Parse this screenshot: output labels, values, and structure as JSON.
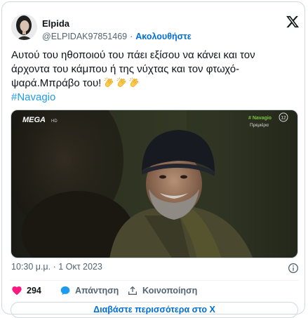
{
  "author": {
    "name": "Elpida",
    "handle": "@ELPIDAK97851469",
    "separator": "·",
    "follow_label": "Ακολουθήστε"
  },
  "tweet": {
    "text_lines": [
      "Αυτού του ηθοποιού του πάει εξίσου να κάνει και τον",
      "άρχοντα του κάμπου ή της νύχτας και τον φτωχό-",
      "ψαρά.Μπράβο του!"
    ],
    "emoji": [
      "clapping-hands",
      "clapping-hands",
      "clapping-hands"
    ],
    "hashtag": "#Navagio"
  },
  "media": {
    "channel_logo": "MEGA",
    "channel_hd": "HD",
    "show_tag": "# Navagio",
    "show_caption": "Πρεμιέρα",
    "rating": "12"
  },
  "meta": {
    "timestamp": "10:30 μ.μ. · 1 Οκτ 2023"
  },
  "actions": {
    "likes": "294",
    "reply_label": "Απάντηση",
    "share_label": "Κοινοποίηση"
  },
  "footer": {
    "read_more_label": "Διαβάστε περισσότερα στο X"
  },
  "colors": {
    "link": "#006fd6",
    "hashtag": "#1d9bf0",
    "like": "#f91880",
    "reply": "#1d9bf0",
    "muted": "#536471",
    "border": "#cfd9de",
    "tag_green": "#7cc242"
  }
}
